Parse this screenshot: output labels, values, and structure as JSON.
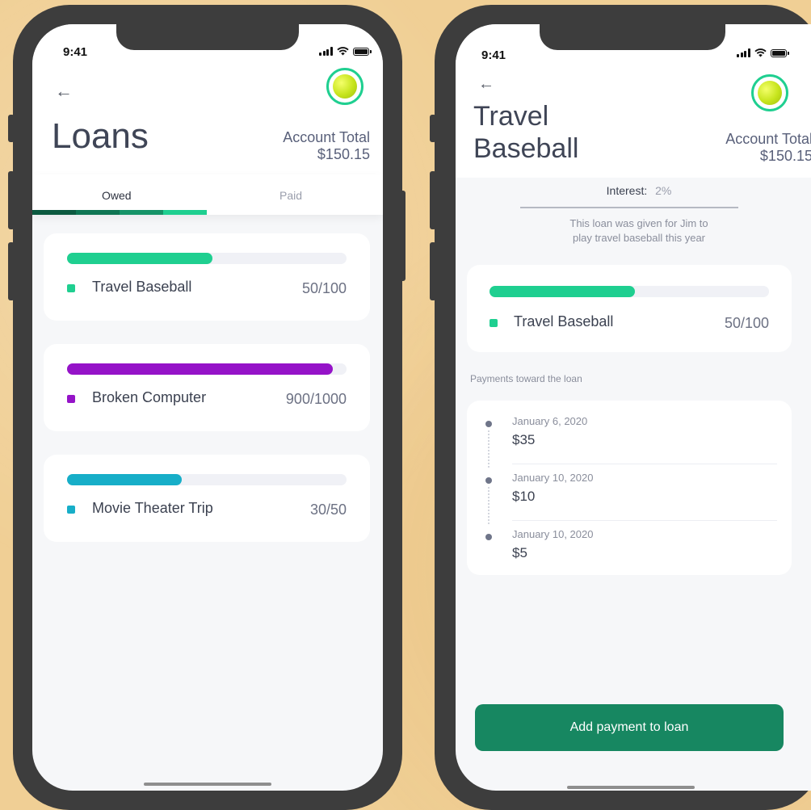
{
  "colors": {
    "accent_green": "#1fcf90",
    "purple": "#9513c8",
    "teal_blue": "#17aec8",
    "cta_green": "#178761"
  },
  "screen1": {
    "status_time": "9:41",
    "title": "Loans",
    "account_total_label": "Account Total",
    "account_total_value": "$150.15",
    "tabs": [
      {
        "label": "Owed",
        "active": true
      },
      {
        "label": "Paid",
        "active": false
      }
    ],
    "loans": [
      {
        "name": "Travel Baseball",
        "amount": "50/100",
        "progress": 0.52,
        "color": "#1fcf90",
        "icon": "square-dot-icon"
      },
      {
        "name": "Broken Computer",
        "amount": "900/1000",
        "progress": 0.95,
        "color": "#9513c8",
        "icon": "square-dot-icon"
      },
      {
        "name": "Movie Theater Trip",
        "amount": "30/50",
        "progress": 0.41,
        "color": "#17aec8",
        "icon": "square-dot-icon"
      }
    ]
  },
  "screen2": {
    "status_time": "9:41",
    "title_line1": "Travel",
    "title_line2": "Baseball",
    "account_total_label": "Account Total",
    "account_total_value": "$150.15",
    "interest_label": "Interest:",
    "interest_value": "2%",
    "description_line1": "This loan was given for Jim to",
    "description_line2": "play travel baseball this year",
    "loan": {
      "name": "Travel Baseball",
      "amount": "50/100",
      "progress": 0.52,
      "color": "#1fcf90"
    },
    "payments_heading": "Payments toward the loan",
    "payments": [
      {
        "date": "January 6, 2020",
        "amount": "$35"
      },
      {
        "date": "January 10, 2020",
        "amount": "$10"
      },
      {
        "date": "January 10, 2020",
        "amount": "$5"
      }
    ],
    "cta_label": "Add payment to loan"
  }
}
